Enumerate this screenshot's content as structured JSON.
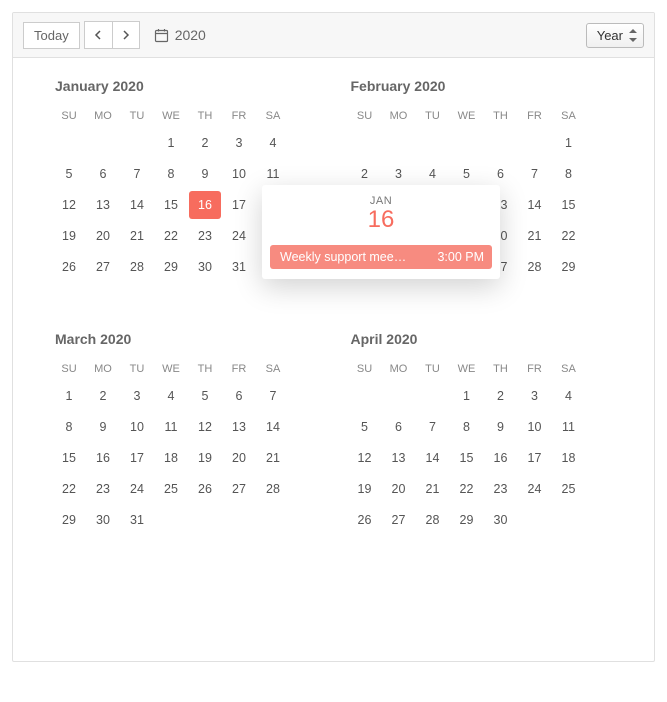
{
  "toolbar": {
    "today_label": "Today",
    "period_label": "2020",
    "view_label": "Year"
  },
  "dow": [
    "SU",
    "MO",
    "TU",
    "WE",
    "TH",
    "FR",
    "SA"
  ],
  "months": [
    {
      "title": "January 2020",
      "lead": 3,
      "days": 31,
      "selected": 16
    },
    {
      "title": "February 2020",
      "lead": 6,
      "days": 29,
      "selected": null
    },
    {
      "title": "March 2020",
      "lead": 0,
      "days": 31,
      "selected": null
    },
    {
      "title": "April 2020",
      "lead": 3,
      "days": 30,
      "selected": null
    }
  ],
  "popover": {
    "month_abbr": "JAN",
    "day": "16",
    "event": {
      "title": "Weekly support mee…",
      "time": "3:00 PM"
    }
  },
  "colors": {
    "accent": "#f76c5e"
  }
}
